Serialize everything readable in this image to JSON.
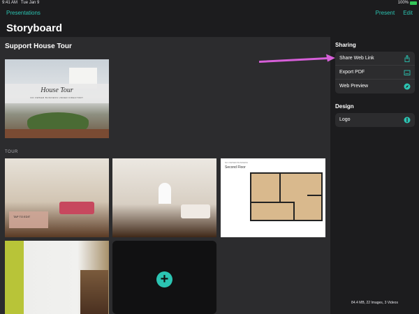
{
  "status": {
    "time": "9:41 AM",
    "date": "Tue Jan 9",
    "battery": "100%"
  },
  "nav": {
    "back": "Presentations",
    "present": "Present",
    "edit": "Edit"
  },
  "title": "Storyboard",
  "main": {
    "section_title": "Support House Tour",
    "cover": {
      "title": "House Tour",
      "subtitle": "DO OWNER BUSINESS UNDER DIRECTORY"
    },
    "tour_label": "TOUR",
    "photo1_caption": "TAP TO EDIT",
    "floorplan": {
      "header": "NO OWNER BUSINESS",
      "floor_label": "Second Floor"
    }
  },
  "sidebar": {
    "sharing_heading": "Sharing",
    "sharing_items": [
      {
        "label": "Share Web Link",
        "icon": "share-icon"
      },
      {
        "label": "Export PDF",
        "icon": "pdf-icon"
      },
      {
        "label": "Web Preview",
        "icon": "compass-icon"
      }
    ],
    "design_heading": "Design",
    "design_items": [
      {
        "label": "Logo",
        "icon": "logo-icon"
      }
    ],
    "footer": "84.4 MB, 22 Images, 3 Videos"
  },
  "colors": {
    "accent": "#2bc4b2",
    "arrow": "#d65fd8",
    "background": "#1c1c1e",
    "panel": "#2c2c2e"
  }
}
